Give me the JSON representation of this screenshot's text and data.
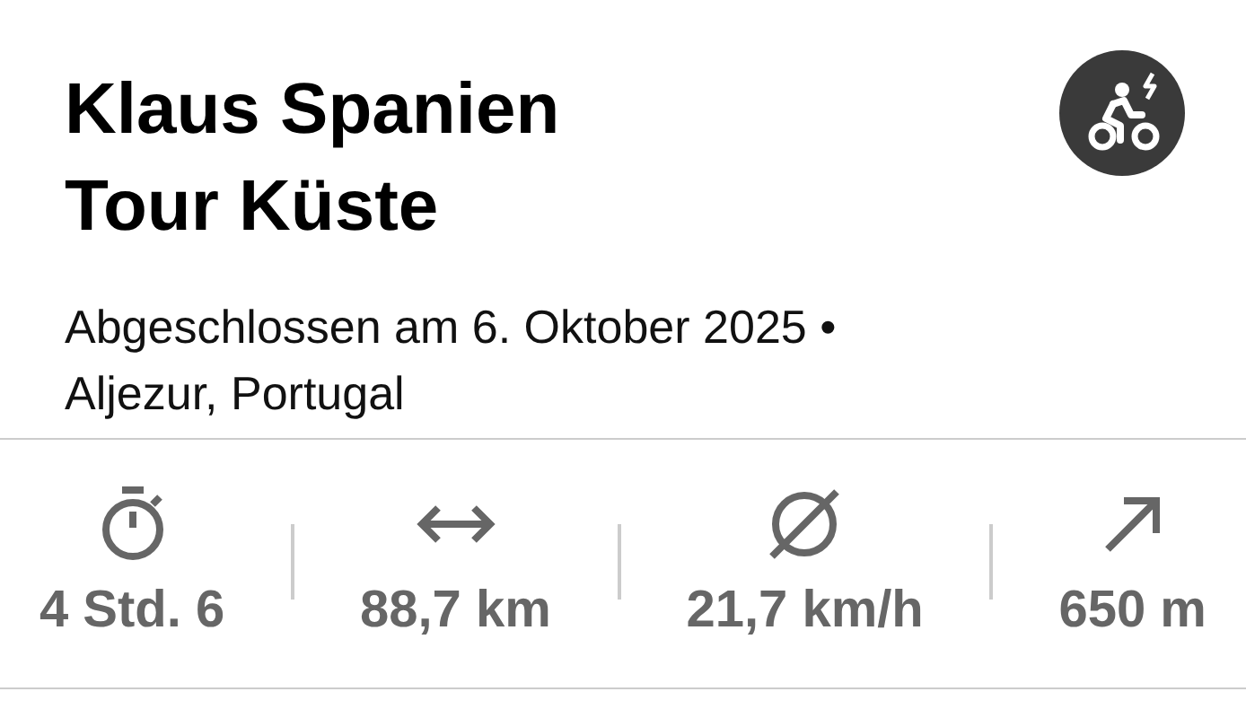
{
  "title_lines": [
    "Klaus Spanien",
    "Tour Küste"
  ],
  "activity_badge": {
    "kind": "ebike"
  },
  "subtitle": "Abgeschlossen am 6. Oktober 2025 •\nAljezur, Portugal",
  "stats": [
    {
      "kind": "duration",
      "value": "4 Std. 6"
    },
    {
      "kind": "distance",
      "value": "88,7 km"
    },
    {
      "kind": "average",
      "value": "21,7 km/h"
    },
    {
      "kind": "elevation",
      "value": "650 m"
    }
  ]
}
